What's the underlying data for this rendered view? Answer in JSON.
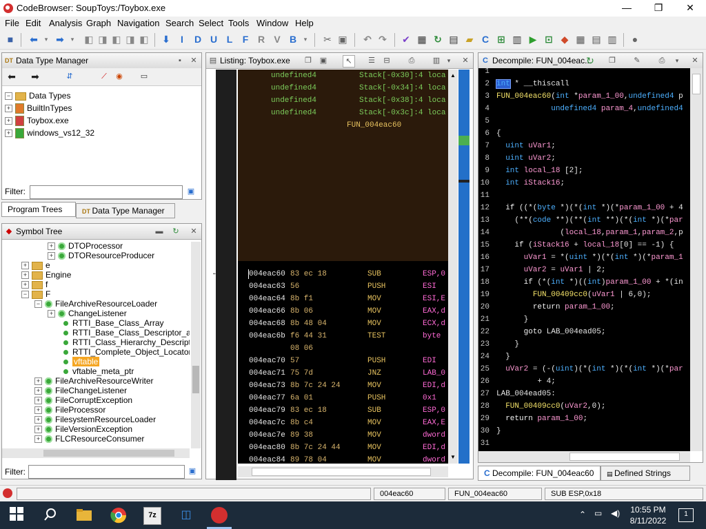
{
  "window": {
    "title": "CodeBrowser: SoupToys:/Toybox.exe",
    "minimize": "—",
    "maximize": "❐",
    "close": "✕"
  },
  "menu": [
    "File",
    "Edit",
    "Analysis",
    "Graph",
    "Navigation",
    "Search",
    "Select",
    "Tools",
    "Window",
    "Help"
  ],
  "toolbar": {
    "letters": [
      "I",
      "D",
      "U",
      "L",
      "F",
      "R",
      "V",
      "B"
    ]
  },
  "data_type_manager": {
    "title": "Data Type Manager",
    "root": "Data Types",
    "items": [
      "BuiltInTypes",
      "Toybox.exe",
      "windows_vs12_32"
    ],
    "filter_label": "Filter:"
  },
  "tabs_left": [
    "Program Trees",
    "Data Type Manager"
  ],
  "symbol_tree": {
    "title": "Symbol Tree",
    "rows": [
      {
        "label": "DTOProcessor",
        "indent": 4,
        "icon": "class",
        "expander": "+"
      },
      {
        "label": "DTOResourceProducer",
        "indent": 4,
        "icon": "class",
        "expander": "+"
      },
      {
        "label": "e",
        "indent": 2,
        "icon": "folder",
        "expander": "+"
      },
      {
        "label": "Engine",
        "indent": 2,
        "icon": "folder",
        "expander": "+"
      },
      {
        "label": "f",
        "indent": 2,
        "icon": "folder",
        "expander": "+"
      },
      {
        "label": "F",
        "indent": 2,
        "icon": "folder",
        "expander": "−"
      },
      {
        "label": "FileArchiveResourceLoader",
        "indent": 3,
        "icon": "class",
        "expander": "−"
      },
      {
        "label": "ChangeListener",
        "indent": 4,
        "icon": "class",
        "expander": "+"
      },
      {
        "label": "RTTI_Base_Class_Array",
        "indent": 5,
        "icon": "dot",
        "expander": ""
      },
      {
        "label": "RTTI_Base_Class_Descriptor_at_(",
        "indent": 5,
        "icon": "dot",
        "expander": ""
      },
      {
        "label": "RTTI_Class_Hierarchy_Descriptor",
        "indent": 5,
        "icon": "dot",
        "expander": ""
      },
      {
        "label": "RTTI_Complete_Object_Locator",
        "indent": 5,
        "icon": "dot",
        "expander": ""
      },
      {
        "label": "vftable",
        "indent": 5,
        "icon": "dot",
        "expander": "",
        "selected": true
      },
      {
        "label": "vftable_meta_ptr",
        "indent": 5,
        "icon": "dot",
        "expander": ""
      },
      {
        "label": "FileArchiveResourceWriter",
        "indent": 3,
        "icon": "class",
        "expander": "+"
      },
      {
        "label": "FileChangeListener",
        "indent": 3,
        "icon": "class",
        "expander": "+"
      },
      {
        "label": "FileCorruptException",
        "indent": 3,
        "icon": "class",
        "expander": "+"
      },
      {
        "label": "FileProcessor",
        "indent": 3,
        "icon": "class",
        "expander": "+"
      },
      {
        "label": "FilesystemResourceLoader",
        "indent": 3,
        "icon": "class",
        "expander": "+"
      },
      {
        "label": "FileVersionException",
        "indent": 3,
        "icon": "class",
        "expander": "+"
      },
      {
        "label": "FLCResourceConsumer",
        "indent": 3,
        "icon": "class",
        "expander": "+"
      }
    ],
    "filter_label": "Filter:"
  },
  "listing": {
    "title": "Listing:  Toybox.exe",
    "stack_rows": [
      {
        "type": "undefined4",
        "stack": "Stack[-0x30]:4 loca"
      },
      {
        "type": "undefined4",
        "stack": "Stack[-0x34]:4 loca"
      },
      {
        "type": "undefined4",
        "stack": "Stack[-0x38]:4 loca"
      },
      {
        "type": "undefined4",
        "stack": "Stack[-0x3c]:4 loca"
      }
    ],
    "function_label": "FUN_004eac60",
    "code_rows": [
      {
        "addr": "004eac60",
        "bytes": "83 ec 18",
        "mnem": "SUB",
        "oper": "ESP,0"
      },
      {
        "addr": "004eac63",
        "bytes": "56",
        "mnem": "PUSH",
        "oper": "ESI"
      },
      {
        "addr": "004eac64",
        "bytes": "8b f1",
        "mnem": "MOV",
        "oper": "ESI,E"
      },
      {
        "addr": "004eac66",
        "bytes": "8b 06",
        "mnem": "MOV",
        "oper": "EAX,d"
      },
      {
        "addr": "004eac68",
        "bytes": "8b 48 04",
        "mnem": "MOV",
        "oper": "ECX,d"
      },
      {
        "addr": "004eac6b",
        "bytes": "f6 44 31",
        "mnem": "TEST",
        "oper": "byte"
      },
      {
        "addr": "",
        "bytes": "08 06",
        "mnem": "",
        "oper": ""
      },
      {
        "addr": "004eac70",
        "bytes": "57",
        "mnem": "PUSH",
        "oper": "EDI"
      },
      {
        "addr": "004eac71",
        "bytes": "75 7d",
        "mnem": "JNZ",
        "oper": "LAB_0"
      },
      {
        "addr": "004eac73",
        "bytes": "8b 7c 24 24",
        "mnem": "MOV",
        "oper": "EDI,d"
      },
      {
        "addr": "004eac77",
        "bytes": "6a 01",
        "mnem": "PUSH",
        "oper": "0x1"
      },
      {
        "addr": "004eac79",
        "bytes": "83 ec 18",
        "mnem": "SUB",
        "oper": "ESP,0"
      },
      {
        "addr": "004eac7c",
        "bytes": "8b c4",
        "mnem": "MOV",
        "oper": "EAX,E"
      },
      {
        "addr": "004eac7e",
        "bytes": "89 38",
        "mnem": "MOV",
        "oper": "dword"
      },
      {
        "addr": "004eac80",
        "bytes": "8b 7c 24 44",
        "mnem": "MOV",
        "oper": "EDI,d"
      },
      {
        "addr": "004eac84",
        "bytes": "89 78 04",
        "mnem": "MOV",
        "oper": "dword"
      }
    ]
  },
  "decompile": {
    "title": "Decompile: FUN_004eac...",
    "lines": [
      {
        "n": "1",
        "html": ""
      },
      {
        "n": "2",
        "html": "<span class='ty'>int</span><span class='pl'> * __thiscall</span>"
      },
      {
        "n": "3",
        "html": "<span class='fn'>FUN_004eac60</span><span class='pl'>(</span><span class='ty'>int</span><span class='pl'> *</span><span class='var'>param_1_00</span><span class='pl'>,</span><span class='ty'>undefined4</span><span class='pl'> p</span>"
      },
      {
        "n": "4",
        "html": "<span class='pl'>            </span><span class='ty'>undefined4</span><span class='pl'> </span><span class='var'>param_4</span><span class='pl'>,</span><span class='ty'>undefined4</span>"
      },
      {
        "n": "5",
        "html": ""
      },
      {
        "n": "6",
        "html": "<span class='pl'>{</span>"
      },
      {
        "n": "7",
        "html": "<span class='pl'>  </span><span class='ty'>uint</span><span class='pl'> </span><span class='var'>uVar1</span><span class='pl'>;</span>"
      },
      {
        "n": "8",
        "html": "<span class='pl'>  </span><span class='ty'>uint</span><span class='pl'> </span><span class='var'>uVar2</span><span class='pl'>;</span>"
      },
      {
        "n": "9",
        "html": "<span class='pl'>  </span><span class='ty'>int</span><span class='pl'> </span><span class='var'>local_18</span><span class='pl'> [2];</span>"
      },
      {
        "n": "10",
        "html": "<span class='pl'>  </span><span class='ty'>int</span><span class='pl'> </span><span class='var'>iStack16</span><span class='pl'>;</span>"
      },
      {
        "n": "11",
        "html": ""
      },
      {
        "n": "12",
        "html": "<span class='pl'>  </span><span class='kw'>if</span><span class='pl'> ((*(</span><span class='ty'>byte</span><span class='pl'> *)(*(</span><span class='ty'>int</span><span class='pl'> *)(*</span><span class='var'>param_1_00</span><span class='pl'> + 4</span>"
      },
      {
        "n": "13",
        "html": "<span class='pl'>    (**(</span><span class='ty'>code</span><span class='pl'> **)(**(</span><span class='ty'>int</span><span class='pl'> **)(*(</span><span class='ty'>int</span><span class='pl'> *)(*</span><span class='var'>par</span>"
      },
      {
        "n": "14",
        "html": "<span class='pl'>              (</span><span class='var'>local_18</span><span class='pl'>,</span><span class='var'>param_1</span><span class='pl'>,</span><span class='var'>param_2</span><span class='pl'>,p</span>"
      },
      {
        "n": "15",
        "html": "<span class='pl'>    </span><span class='kw'>if</span><span class='pl'> (</span><span class='var'>iStack16</span><span class='pl'> + </span><span class='var'>local_18</span><span class='pl'>[0] == -1) {</span>"
      },
      {
        "n": "16",
        "html": "<span class='pl'>      </span><span class='var'>uVar1</span><span class='pl'> = *(</span><span class='ty'>uint</span><span class='pl'> *)(*(</span><span class='ty'>int</span><span class='pl'> *)(*</span><span class='var'>param_1</span>"
      },
      {
        "n": "17",
        "html": "<span class='pl'>      </span><span class='var'>uVar2</span><span class='pl'> = </span><span class='var'>uVar1</span><span class='pl'> | 2;</span>"
      },
      {
        "n": "18",
        "html": "<span class='pl'>      </span><span class='kw'>if</span><span class='pl'> (*(</span><span class='ty'>int</span><span class='pl'> *)((</span><span class='ty'>int</span><span class='pl'>)</span><span class='var'>param_1_00</span><span class='pl'> + *(in</span>"
      },
      {
        "n": "19",
        "html": "<span class='pl'>        </span><span class='fn'>FUN_00409cc0</span><span class='pl'>(</span><span class='var'>uVar1</span><span class='pl'> | 6,0);</span>"
      },
      {
        "n": "20",
        "html": "<span class='pl'>        </span><span class='kw'>return</span><span class='pl'> </span><span class='var'>param_1_00</span><span class='pl'>;</span>"
      },
      {
        "n": "21",
        "html": "<span class='pl'>      }</span>"
      },
      {
        "n": "22",
        "html": "<span class='pl'>      </span><span class='kw'>goto</span><span class='pl'> LAB_004ead05;</span>"
      },
      {
        "n": "23",
        "html": "<span class='pl'>    }</span>"
      },
      {
        "n": "24",
        "html": "<span class='pl'>  }</span>"
      },
      {
        "n": "25",
        "html": "<span class='pl'>  </span><span class='var'>uVar2</span><span class='pl'> = (-(</span><span class='ty'>uint</span><span class='pl'>)(*(</span><span class='ty'>int</span><span class='pl'> *)(*(</span><span class='ty'>int</span><span class='pl'> *)(*</span><span class='var'>par</span>"
      },
      {
        "n": "26",
        "html": "<span class='pl'>         + 4;</span>"
      },
      {
        "n": "27",
        "html": "<span class='pl'>LAB_004ead05:</span>"
      },
      {
        "n": "28",
        "html": "<span class='pl'>  </span><span class='fn'>FUN_00409cc0</span><span class='pl'>(</span><span class='var'>uVar2</span><span class='pl'>,0);</span>"
      },
      {
        "n": "29",
        "html": "<span class='pl'>  </span><span class='kw'>return</span><span class='pl'> </span><span class='var'>param_1_00</span><span class='pl'>;</span>"
      },
      {
        "n": "30",
        "html": "<span class='pl'>}</span>"
      },
      {
        "n": "31",
        "html": ""
      }
    ]
  },
  "tabs_right": [
    "Decompile: FUN_004eac60",
    "Defined Strings"
  ],
  "status": {
    "address": "004eac60",
    "function": "FUN_004eac60",
    "instruction": "SUB ESP,0x18"
  },
  "taskbar": {
    "time": "10:55 PM",
    "date": "8/11/2022",
    "notification_count": "1"
  },
  "colors": {
    "listing_bg": "#000000",
    "listing_header_bg": "#2b1a0b",
    "overview_bar": "#2370c9",
    "selection_highlight": "#f5a623",
    "taskbar": "#1c2b3a"
  }
}
